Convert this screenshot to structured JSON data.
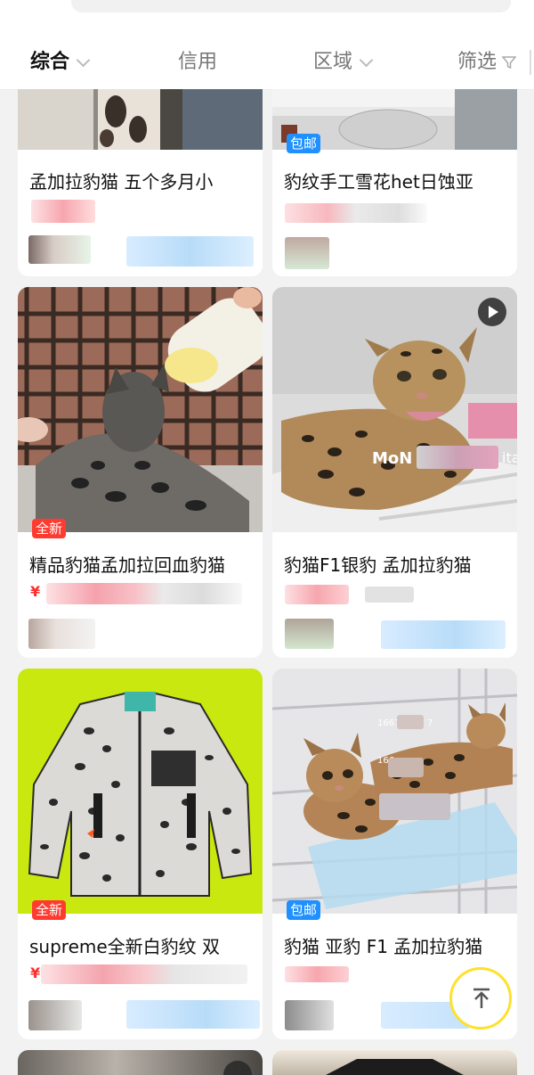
{
  "filter_bar": {
    "tabs": [
      {
        "label": "综合",
        "active": true,
        "has_arrow": true
      },
      {
        "label": "信用",
        "active": false,
        "has_arrow": false
      },
      {
        "label": "区域",
        "active": false,
        "has_arrow": true
      },
      {
        "label": "筛选",
        "active": false,
        "icon": "filter-icon"
      }
    ]
  },
  "cards": [
    {
      "title": "孟加拉豹猫 五个多月小",
      "badge": ""
    },
    {
      "title": "豹纹手工雪花het日蚀亚",
      "badge": "包邮"
    },
    {
      "title": "精品豹猫孟加拉回血豹猫",
      "badge": "全新",
      "price": "¥"
    },
    {
      "title": "豹猫F1银豹 孟加拉豹猫",
      "badge": "",
      "video": true
    },
    {
      "title": "supreme全新白豹纹 双",
      "badge": "全新",
      "price": "¥"
    },
    {
      "title": "豹猫 亚豹 F1 孟加拉豹猫",
      "badge": "包邮"
    }
  ],
  "photo_overlays": {
    "watermark": "MoN",
    "watermark_suffix": "ita",
    "cage_text_1": "1667",
    "cage_text_1_suffix": "7",
    "cage_text_2": "166"
  },
  "colors": {
    "badge_new": "#ff3b30",
    "badge_free_shipping": "#1e90ff",
    "price": "#ff2d2d",
    "back_to_top_ring": "#ffe12b"
  },
  "back_to_top_icon": "back-to-top-icon"
}
